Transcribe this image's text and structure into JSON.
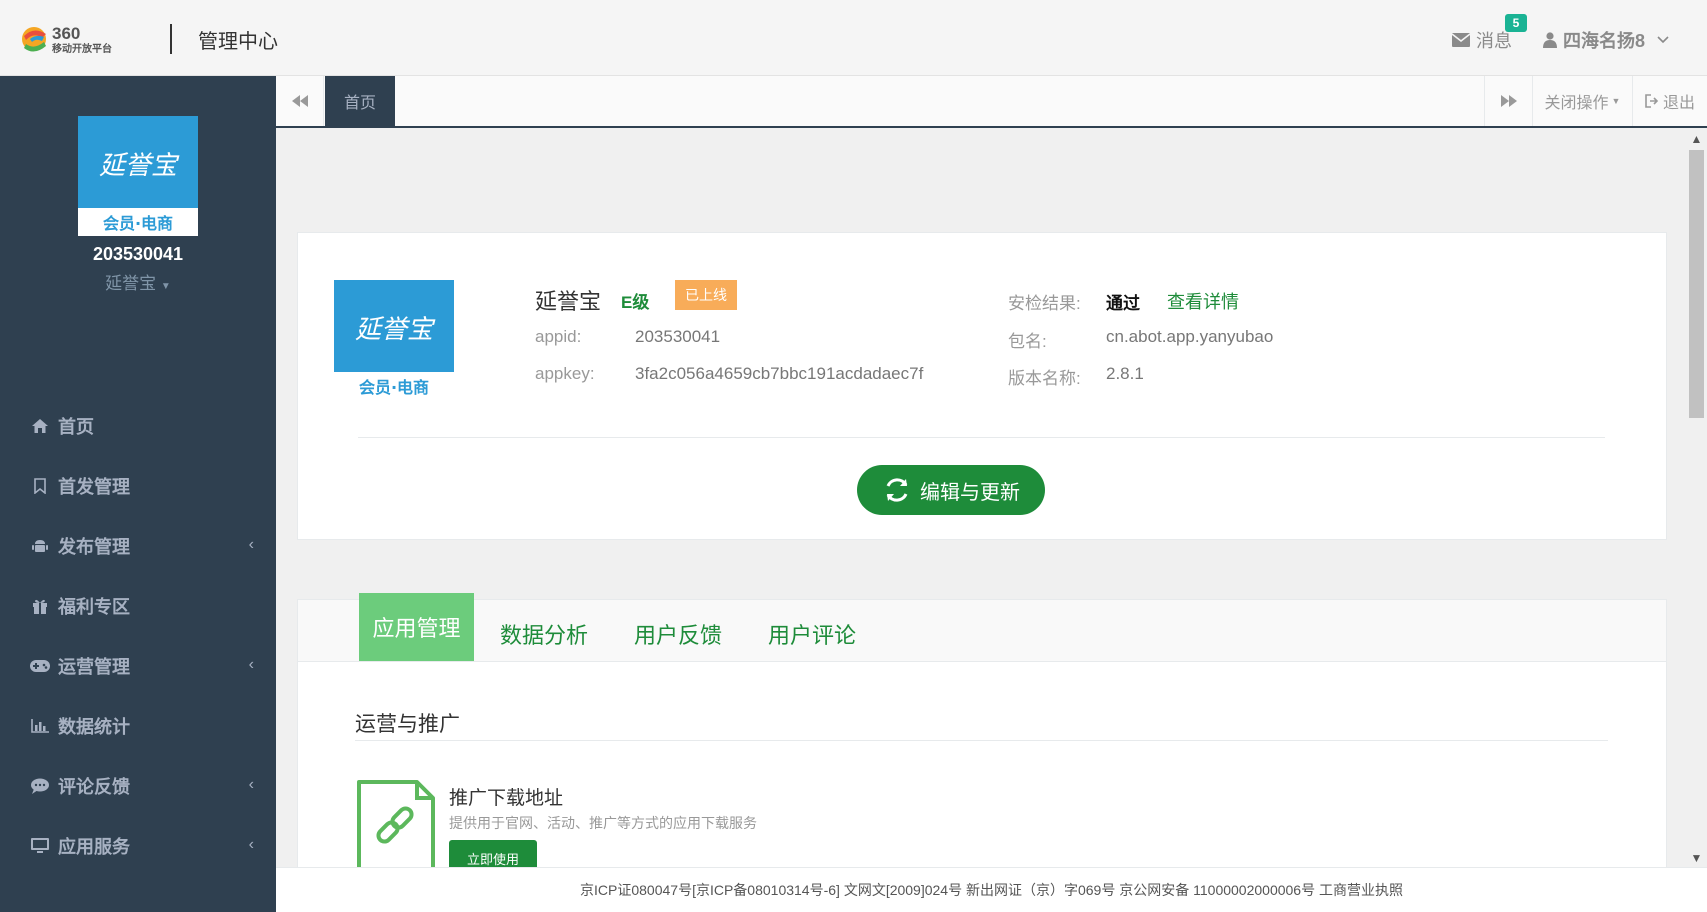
{
  "header": {
    "logo_text": "360",
    "logo_subtext": "移动开放平台",
    "title": "管理中心",
    "messages_label": "消息",
    "messages_count": "5",
    "username": "四海名扬8"
  },
  "sidebar": {
    "avatar_line1": "延誉宝",
    "avatar_line2": "会员·电商",
    "app_id": "203530041",
    "app_name": "延誉宝",
    "items": [
      {
        "label": "首页",
        "icon": "home-icon",
        "has_submenu": false
      },
      {
        "label": "首发管理",
        "icon": "bookmark-icon",
        "has_submenu": false
      },
      {
        "label": "发布管理",
        "icon": "android-icon",
        "has_submenu": true
      },
      {
        "label": "福利专区",
        "icon": "gift-icon",
        "has_submenu": false
      },
      {
        "label": "运营管理",
        "icon": "gamepad-icon",
        "has_submenu": true
      },
      {
        "label": "数据统计",
        "icon": "bar-chart-icon",
        "has_submenu": false
      },
      {
        "label": "评论反馈",
        "icon": "comment-icon",
        "has_submenu": true
      },
      {
        "label": "应用服务",
        "icon": "desktop-icon",
        "has_submenu": true
      }
    ]
  },
  "tabbar": {
    "home_tab": "首页",
    "close_ops": "关闭操作",
    "exit": "退出"
  },
  "app_card": {
    "name": "延誉宝",
    "grade": "E级",
    "status": "已上线",
    "appid_label": "appid:",
    "appid": "203530041",
    "appkey_label": "appkey:",
    "appkey": "3fa2c056a4659cb7bbc191acdadaec7f",
    "security_label": "安检结果:",
    "security_value": "通过",
    "security_link": "查看详情",
    "package_label": "包名:",
    "package": "cn.abot.app.yanyubao",
    "version_label": "版本名称:",
    "version": "2.8.1",
    "edit_button": "编辑与更新"
  },
  "tabs_card": {
    "tabs": [
      "应用管理",
      "数据分析",
      "用户反馈",
      "用户评论"
    ],
    "active_tab": "应用管理",
    "section_title": "运营与推广",
    "promo_title": "推广下载地址",
    "promo_desc": "提供用于官网、活动、推广等方式的应用下载服务",
    "promo_button": "立即使用"
  },
  "footer": {
    "text": "京ICP证080047号[京ICP备08010314号-6] 文网文[2009]024号 新出网证（京）字069号 京公网安备 11000002000006号 工商营业执照"
  },
  "colors": {
    "sidebar_bg": "#2f4050",
    "brand_green": "#1e8c3a",
    "active_tab_green": "#6ccc7c",
    "status_orange": "#f8ac59",
    "badge_teal": "#1ab394",
    "avatar_blue": "#2c9bd6"
  }
}
